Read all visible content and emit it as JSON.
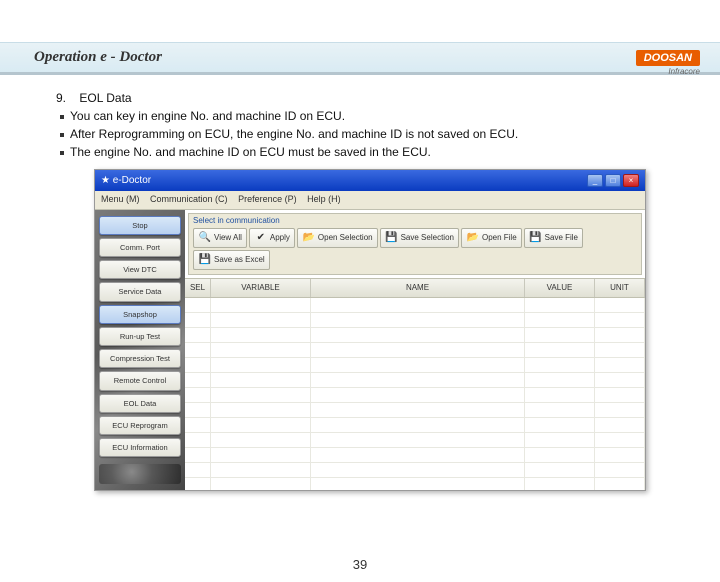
{
  "brand": {
    "main": "DOOSAN",
    "sub": "Infracore"
  },
  "title": "Operation e - Doctor",
  "section": {
    "number": "9.",
    "heading": "EOL Data",
    "bullets": [
      "You can key in engine No. and machine ID on ECU.",
      "After Reprogramming on ECU, the engine No. and machine ID is not saved on ECU.",
      "The engine No. and machine ID on ECU must be saved in the ECU."
    ]
  },
  "app": {
    "window_title": "e-Doctor",
    "window_icon": "★",
    "menu": [
      "Menu (M)",
      "Communication (C)",
      "Preference (P)",
      "Help (H)"
    ],
    "sidebar": [
      "Stop",
      "Comm. Port",
      "View DTC",
      "Service Data",
      "Snapshop",
      "Run-up Test",
      "Compression Test",
      "Remote Control",
      "EOL Data",
      "ECU Reprogram",
      "ECU Information"
    ],
    "toolbar": {
      "group_label": "Select in communication",
      "buttons": [
        {
          "icon": "🔍",
          "label": "View All"
        },
        {
          "icon": "✔",
          "label": "Apply"
        },
        {
          "icon": "📂",
          "label": "Open Selection"
        },
        {
          "icon": "💾",
          "label": "Save Selection"
        },
        {
          "icon": "📂",
          "label": "Open File"
        },
        {
          "icon": "💾",
          "label": "Save File"
        },
        {
          "icon": "💾",
          "label": "Save as Excel"
        }
      ]
    },
    "grid_headers": {
      "sel": "SEL",
      "var": "VARIABLE",
      "name": "NAME",
      "val": "VALUE",
      "unit": "UNIT"
    },
    "win_buttons": {
      "min": "_",
      "max": "□",
      "close": "×"
    }
  },
  "page_number": "39"
}
